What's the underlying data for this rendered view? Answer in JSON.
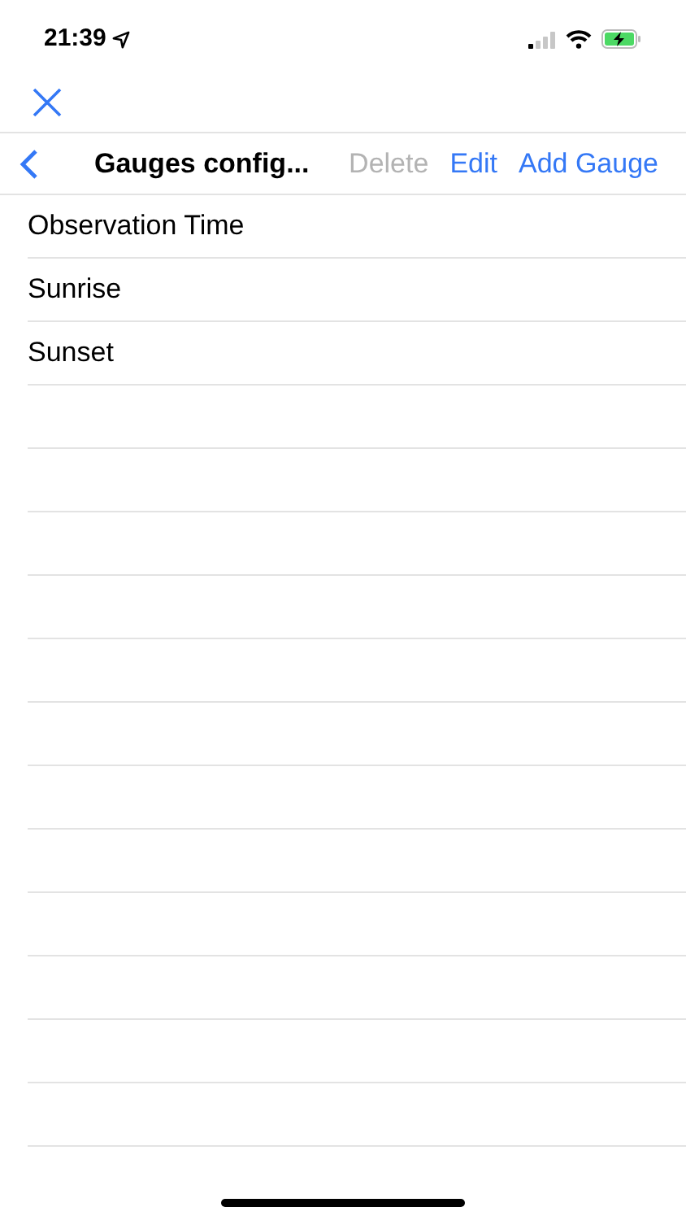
{
  "status_bar": {
    "time": "21:39"
  },
  "nav_bar": {
    "title": "Gauges config...",
    "actions": [
      {
        "label": "Delete",
        "disabled": true
      },
      {
        "label": "Edit",
        "disabled": false
      },
      {
        "label": "Add Gauge",
        "disabled": false
      }
    ]
  },
  "list": {
    "items": [
      {
        "label": "Observation Time"
      },
      {
        "label": "Sunrise"
      },
      {
        "label": "Sunset"
      }
    ]
  }
}
